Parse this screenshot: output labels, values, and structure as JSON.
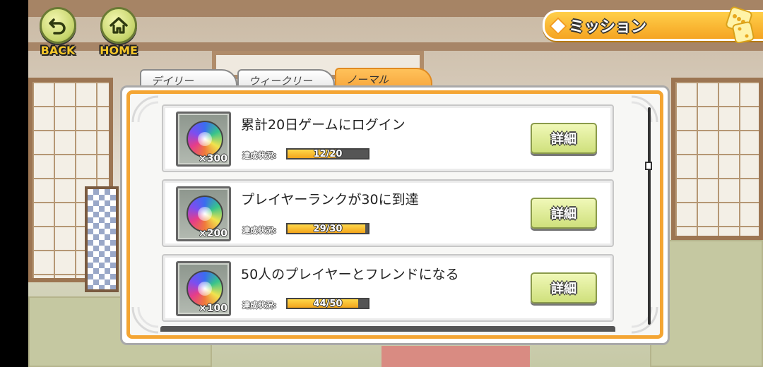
{
  "nav": {
    "back_label": "BACK",
    "home_label": "HOME"
  },
  "header": {
    "title": "ミッション"
  },
  "tabs": [
    {
      "label": "デイリー",
      "active": false
    },
    {
      "label": "ウィークリー",
      "active": false
    },
    {
      "label": "ノーマル",
      "active": true
    }
  ],
  "missions": [
    {
      "title": "累計20日ゲームにログイン",
      "progress_label": "達成状況:",
      "progress_text": "12/20",
      "progress": 0.6,
      "reward_qty": "×300",
      "detail_label": "詳細"
    },
    {
      "title": "プレイヤーランクが30に到達",
      "progress_label": "達成状況:",
      "progress_text": "29/30",
      "progress": 0.9667,
      "reward_qty": "×200",
      "detail_label": "詳細"
    },
    {
      "title": "50人のプレイヤーとフレンドになる",
      "progress_label": "達成状況:",
      "progress_text": "44/50",
      "progress": 0.88,
      "reward_qty": "×100",
      "detail_label": "詳細"
    }
  ],
  "colors": {
    "accent": "#f4a533",
    "button_green": "#cfe07c",
    "progress_fill": "#f3a51c"
  },
  "icons": {
    "back": "back-arrow-icon",
    "home": "home-icon",
    "reward": "rainbow-gem-icon",
    "title_deco": "dice-icon"
  }
}
